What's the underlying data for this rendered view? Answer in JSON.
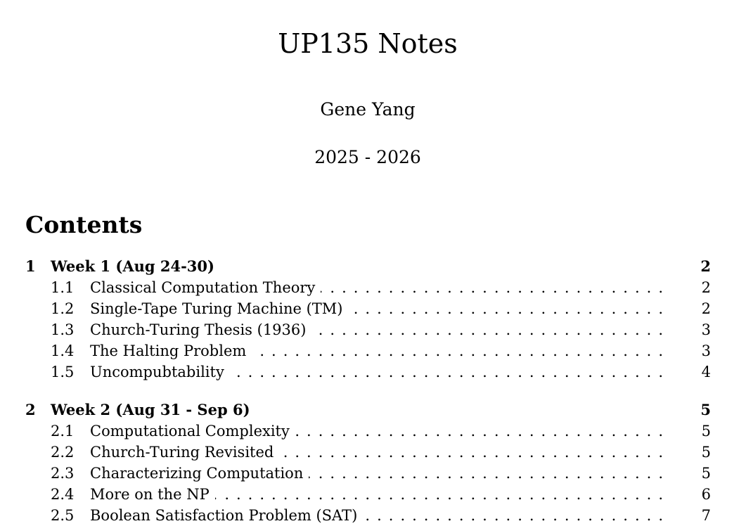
{
  "document": {
    "title": "UP135 Notes",
    "author": "Gene Yang",
    "date": "2025 - 2026"
  },
  "toc": {
    "heading": "Contents",
    "sections": [
      {
        "number": "1",
        "title": "Week 1 (Aug 24-30)",
        "page": "2",
        "subsections": [
          {
            "number": "1.1",
            "title": "Classical Computation Theory",
            "page": "2"
          },
          {
            "number": "1.2",
            "title": "Single-Tape Turing Machine (TM)",
            "page": "2"
          },
          {
            "number": "1.3",
            "title": "Church-Turing Thesis (1936)",
            "page": "3"
          },
          {
            "number": "1.4",
            "title": "The Halting Problem",
            "page": "3"
          },
          {
            "number": "1.5",
            "title": "Uncompubtability",
            "page": "4"
          }
        ]
      },
      {
        "number": "2",
        "title": "Week 2 (Aug 31 - Sep 6)",
        "page": "5",
        "subsections": [
          {
            "number": "2.1",
            "title": "Computational Complexity",
            "page": "5"
          },
          {
            "number": "2.2",
            "title": "Church-Turing Revisited",
            "page": "5"
          },
          {
            "number": "2.3",
            "title": "Characterizing Computation",
            "page": "5"
          },
          {
            "number": "2.4",
            "title": "More on the NP",
            "page": "6"
          },
          {
            "number": "2.5",
            "title": "Boolean Satisfaction Problem (SAT)",
            "page": "7"
          }
        ]
      }
    ]
  }
}
